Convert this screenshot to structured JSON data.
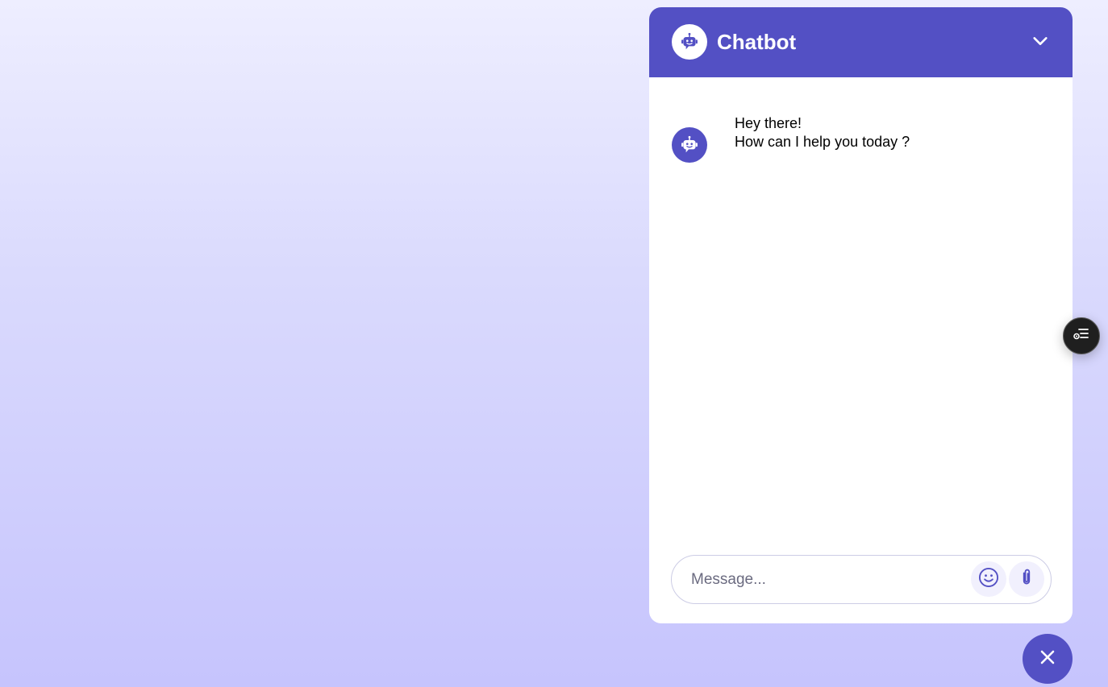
{
  "header": {
    "title": "Chatbot",
    "avatar_icon": "chatbot-logo-icon",
    "collapse_icon": "chevron-down-icon"
  },
  "messages": [
    {
      "sender": "bot",
      "lines": [
        "Hey there!",
        "How can I help you today ?"
      ]
    }
  ],
  "footer": {
    "input_value": "",
    "input_placeholder": "Message...",
    "emoji_icon": "smiley-icon",
    "attach_icon": "paperclip-icon"
  },
  "side_widget": {
    "icon": "list-settings-icon"
  },
  "toggler": {
    "icon": "close-icon"
  },
  "colors": {
    "primary": "#5350C4",
    "header_text": "#FFFFFF",
    "button_bg": "#F1F0FD",
    "background_top": "#EEEEFF",
    "background_bottom": "#C6C4FD"
  }
}
